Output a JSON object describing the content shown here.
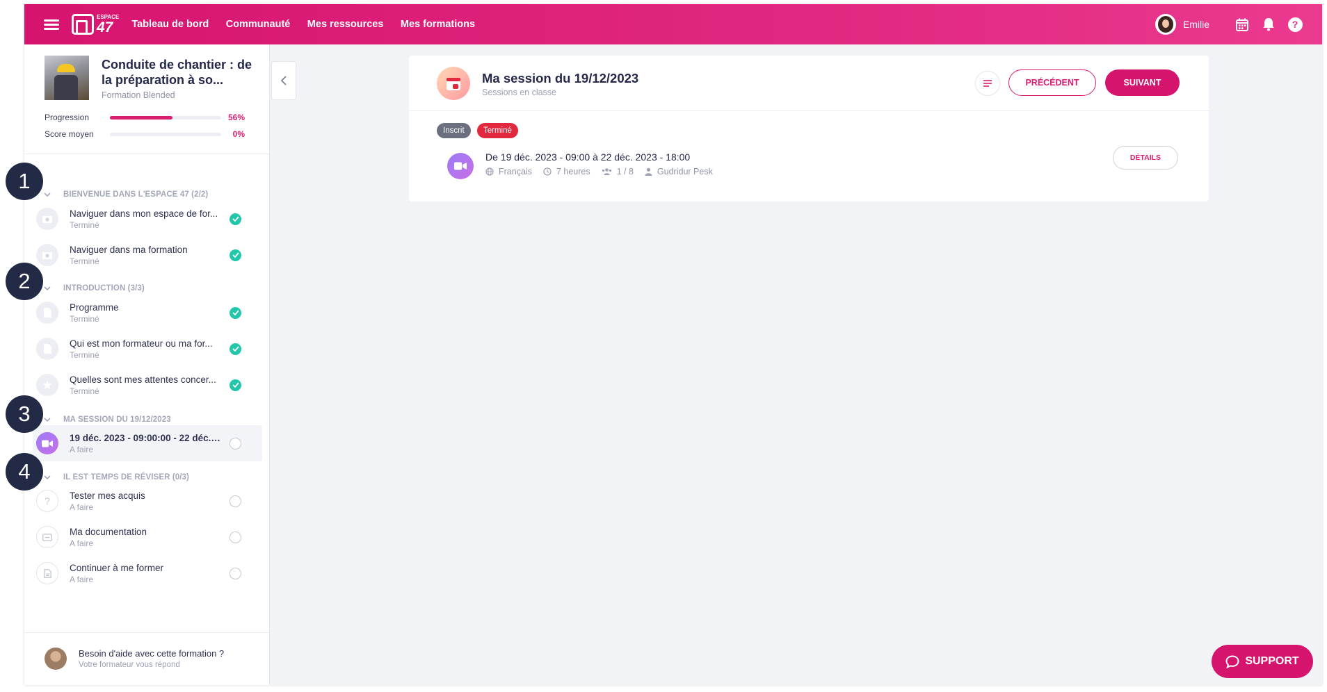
{
  "topbar": {
    "logo_small": "ESPACE",
    "logo_num": "47",
    "nav": [
      "Tableau de bord",
      "Communauté",
      "Mes ressources",
      "Mes formations"
    ],
    "username": "Emilie"
  },
  "course": {
    "title": "Conduite de chantier : de la préparation à so...",
    "type": "Formation Blended",
    "progress_label": "Progression",
    "progress_value": "56%",
    "progress_fraction": 0.56,
    "score_label": "Score moyen",
    "score_value": "0%",
    "score_fraction": 0
  },
  "sections": [
    {
      "title": "BIENVENUE DANS L'ESPACE 47 (2/2)",
      "items": [
        {
          "title": "Naviguer dans mon espace de for...",
          "status": "Terminé",
          "icon": "camera-icon",
          "state": "done"
        },
        {
          "title": "Naviguer dans ma formation",
          "status": "Terminé",
          "icon": "camera-icon",
          "state": "done"
        }
      ]
    },
    {
      "title": "INTRODUCTION (3/3)",
      "items": [
        {
          "title": "Programme",
          "status": "Terminé",
          "icon": "document-icon",
          "state": "done"
        },
        {
          "title": "Qui est mon formateur ou ma for...",
          "status": "Terminé",
          "icon": "document-icon",
          "state": "done"
        },
        {
          "title": "Quelles sont mes attentes concer...",
          "status": "Terminé",
          "icon": "star-icon",
          "state": "done"
        }
      ]
    },
    {
      "title": "MA SESSION DU 19/12/2023",
      "items": [
        {
          "title": "19 déc. 2023 - 09:00:00 - 22 déc. 2...",
          "status": "A faire",
          "icon": "video-icon",
          "state": "todo"
        }
      ]
    },
    {
      "title": "IL EST TEMPS DE RÉVISER (0/3)",
      "items": [
        {
          "title": "Tester mes acquis",
          "status": "A faire",
          "icon": "question-icon",
          "state": "todo"
        },
        {
          "title": "Ma documentation",
          "status": "A faire",
          "icon": "library-icon",
          "state": "todo"
        },
        {
          "title": "Continuer à me former",
          "status": "A faire",
          "icon": "file-icon",
          "state": "todo"
        }
      ]
    }
  ],
  "help": {
    "title": "Besoin d'aide avec cette formation ?",
    "subtitle": "Votre formateur vous répond"
  },
  "markers": [
    "1",
    "2",
    "3",
    "4"
  ],
  "session": {
    "title": "Ma session du 19/12/2023",
    "subtitle": "Sessions en classe",
    "prev_label": "PRÉCÉDENT",
    "next_label": "SUIVANT",
    "badges": [
      "Inscrit",
      "Terminé"
    ],
    "date_range": "De 19 déc. 2023 - 09:00 à 22 déc. 2023 - 18:00",
    "language": "Français",
    "duration": "7 heures",
    "attendees": "1 / 8",
    "trainer": "Gudridur Pesk",
    "details_label": "DÉTAILS"
  },
  "support_label": "SUPPORT",
  "colors": {
    "brand": "#d4146d",
    "success": "#22c7ab",
    "badge_grey": "#6b6f80",
    "badge_red": "#e2283e",
    "marker": "#222a46"
  }
}
